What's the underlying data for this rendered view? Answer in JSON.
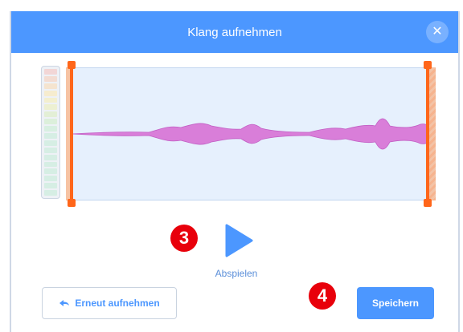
{
  "dialog": {
    "title": "Klang aufnehmen",
    "close_icon": "close-icon"
  },
  "player": {
    "play_label": "Abspielen",
    "play_icon": "play-icon"
  },
  "buttons": {
    "rerecord_label": "Erneut aufnehmen",
    "rerecord_icon": "back-arrow-icon",
    "save_label": "Speichern"
  },
  "annotations": {
    "step_play": "3",
    "step_save": "4"
  },
  "colors": {
    "accent": "#4c97ff",
    "trim": "#ff661a",
    "waveform": "#d97ed9",
    "badge": "#e8000b"
  }
}
